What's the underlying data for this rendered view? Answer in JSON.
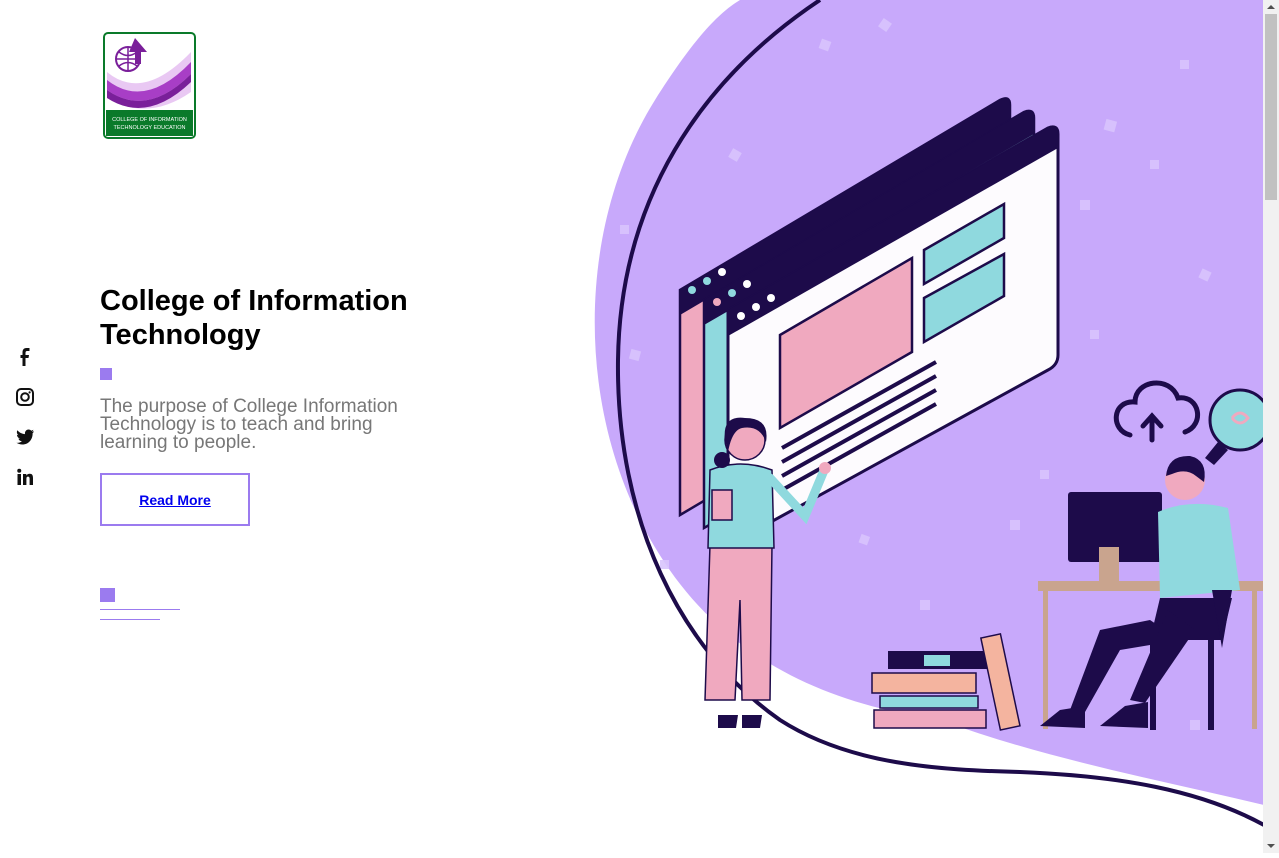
{
  "logo": {
    "line1": "COLLEGE OF INFORMATION",
    "line2": "TECHNOLOGY EDUCATION"
  },
  "social": {
    "icons": [
      "facebook-icon",
      "instagram-icon",
      "twitter-icon",
      "linkedin-icon"
    ]
  },
  "hero": {
    "title": "College of Information Technology",
    "description": "The purpose of College Information Technology is to teach and bring learning to people.",
    "cta_label": "Read More"
  },
  "colors": {
    "accent": "#9b7bef",
    "menu": "#f58aa0",
    "blob": "#c8a9fb",
    "dark": "#1d0b4a",
    "pink": "#f0a9bf",
    "teal": "#8fd9de"
  }
}
